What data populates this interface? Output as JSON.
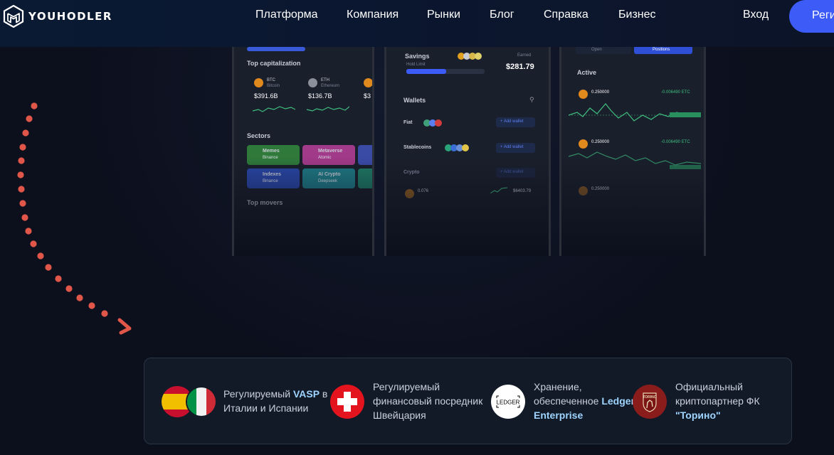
{
  "brand": {
    "name": "YOUHODLER"
  },
  "nav": {
    "items": [
      {
        "label": "Платформа"
      },
      {
        "label": "Компания"
      },
      {
        "label": "Рынки"
      },
      {
        "label": "Блог"
      },
      {
        "label": "Справка"
      },
      {
        "label": "Бизнес"
      }
    ],
    "login_label": "Вход",
    "register_label": "Регистрация"
  },
  "phones": {
    "left": {
      "section_top": "Top capitalization",
      "cards": [
        {
          "ticker": "BTC",
          "sub": "Bitcoin",
          "value": "$391.6B"
        },
        {
          "ticker": "ETH",
          "sub": "Ethereum",
          "value": "$136.7B"
        },
        {
          "ticker": "",
          "sub": "",
          "value": "$3"
        }
      ],
      "section_sectors": "Sectors",
      "sectors": [
        {
          "name": "Memes",
          "sub": "Binance"
        },
        {
          "name": "Metaverse",
          "sub": "Atomic"
        },
        {
          "name": "Indexes",
          "sub": "Binance"
        },
        {
          "name": "AI Crypto",
          "sub": "Deepseek"
        }
      ],
      "section_movers": "Top movers"
    },
    "middle": {
      "savings_label": "Savings",
      "earned_label": "Earned",
      "savings_value": "$281.79",
      "hold_label": "Hold Limit",
      "wallets_label": "Wallets",
      "rows": [
        {
          "label": "Fiat",
          "action": "+ Add wallet"
        },
        {
          "label": "Stablecoins",
          "action": "+ Add wallet"
        },
        {
          "label": "Crypto",
          "action": "+ Add wallet"
        }
      ],
      "crypto_row": {
        "amount": "0.076",
        "value": "$6403.79"
      }
    },
    "right": {
      "tabs": [
        "Open",
        "Positions"
      ],
      "active_label": "Active",
      "trades": [
        {
          "amount": "0.250000",
          "change": "-0.006490 ETC"
        },
        {
          "amount": "0.250000",
          "change": "-0.006490 ETC"
        },
        {
          "amount": "0.250000",
          "change": ""
        }
      ]
    }
  },
  "badges": [
    {
      "text_a": "Регулируемый ",
      "strong": "VASP",
      "text_b": " в",
      "line2": "Италии и Испании"
    },
    {
      "line1": "Регулируемый",
      "line2": "финансовый посредник",
      "line3": "Швейцария"
    },
    {
      "line1": "Хранение,",
      "line2a": "обеспеченное ",
      "strong": "Ledger",
      "strong2": "Enterprise",
      "logo": "LEDGER"
    },
    {
      "line1": "Официальный",
      "line2": "криптопартнер ФК",
      "strong": "\"Торино\"",
      "logo": "TORINO"
    }
  ],
  "colors": {
    "accent": "#3d5bf7",
    "arrow": "#e0574a",
    "panel_bg": "#121a27",
    "highlight": "#9ed4ff"
  }
}
